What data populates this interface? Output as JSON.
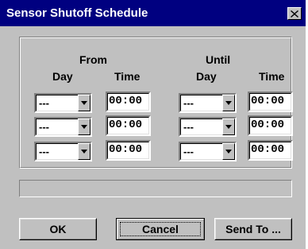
{
  "window": {
    "title": "Sensor Shutoff Schedule",
    "close_glyph": "close-icon"
  },
  "headers": {
    "from": "From",
    "until": "Until",
    "from_day": "Day",
    "from_time": "Time",
    "until_day": "Day",
    "until_time": "Time"
  },
  "rows": [
    {
      "from_day": "---",
      "from_time": "00:00",
      "until_day": "---",
      "until_time": "00:00"
    },
    {
      "from_day": "---",
      "from_time": "00:00",
      "until_day": "---",
      "until_time": "00:00"
    },
    {
      "from_day": "---",
      "from_time": "00:00",
      "until_day": "---",
      "until_time": "00:00"
    }
  ],
  "status": {
    "text": ""
  },
  "buttons": {
    "ok": "OK",
    "cancel": "Cancel",
    "send_to": "Send To ..."
  },
  "colors": {
    "titlebar": "#000080",
    "face": "#c0c0c0",
    "title_text": "#ffffff"
  }
}
